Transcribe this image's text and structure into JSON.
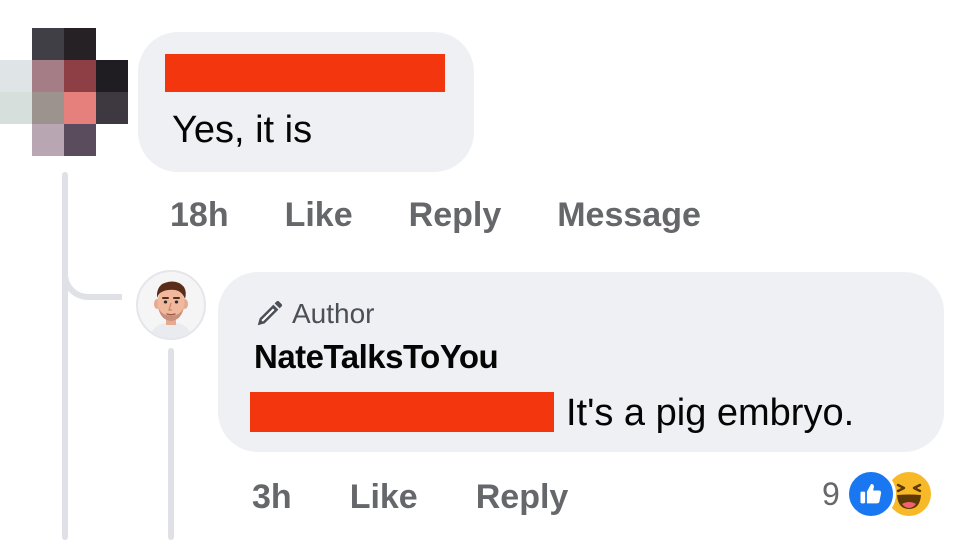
{
  "top_comment": {
    "text": "Yes, it is",
    "timestamp": "18h",
    "like_label": "Like",
    "reply_label": "Reply",
    "message_label": "Message"
  },
  "reply_comment": {
    "badge": "Author",
    "author": "NateTalksToYou",
    "text": "It's a pig embryo.",
    "timestamp": "3h",
    "like_label": "Like",
    "reply_label": "Reply",
    "reaction_count": "9",
    "reactions": [
      "like-icon",
      "haha-icon"
    ]
  },
  "colors": {
    "bubble": "#eff0f4",
    "redaction": "#f4360f",
    "action_text": "#65676b",
    "thread_line": "#dfe1e6",
    "like_blue": "#1a77f2",
    "haha_yellow": "#f7b928"
  }
}
